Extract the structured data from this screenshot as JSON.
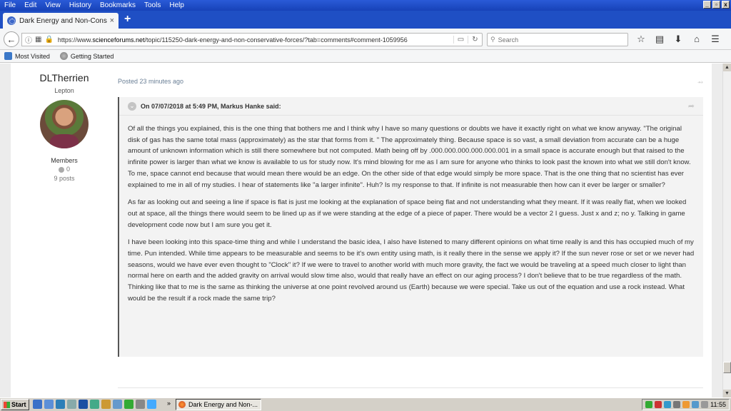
{
  "menu": [
    "File",
    "Edit",
    "View",
    "History",
    "Bookmarks",
    "Tools",
    "Help"
  ],
  "window_buttons": [
    "_",
    "▫",
    "x"
  ],
  "tab": {
    "title": "Dark Energy and Non-Conser...",
    "close": "×"
  },
  "newtab": "+",
  "nav": {
    "url_prefix": "https://www.",
    "url_domain": "scienceforums.net",
    "url_rest": "/topic/115250-dark-energy-and-non-conservative-forces/?tab=comments#comment-1059956",
    "search_placeholder": "Search"
  },
  "bookmarks": [
    "Most Visited",
    "Getting Started"
  ],
  "author": {
    "name": "DLTherrien",
    "rank": "Lepton",
    "group": "Members",
    "reputation": "0",
    "posts": "9 posts"
  },
  "post": {
    "meta": "Posted 23 minutes ago",
    "quote_header": "On 07/07/2018 at 5:49 PM, Markus Hanke said:",
    "paragraphs": [
      "Of all the things you explained, this is the one thing that bothers me and I think why I have so many questions or doubts we have it exactly right on what we know anyway. \"The original disk of gas has the same total mass (approximately) as the star that forms from it. \" The approximately thing. Because space is so vast, a small deviation from accurate can be a huge amount of unknown information which is still there somewhere but not computed. Math being off by .000.000.000.000.000.001 in a small space is accurate enough but that raised to the infinite power is larger than what we know is available to us for study now. It's mind blowing for me as I am sure for anyone who thinks to look past the known into what we still don't know. To me, space cannot end because that would mean there would be an edge. On the other side of that edge would simply be more space. That is the one thing that no scientist has ever explained to me in all of my studies. I hear of statements like \"a larger infinite\". Huh? Is my response to that. If infinite is not measurable then how can it ever be larger or smaller?",
      "As far as looking out and seeing a line if space is flat is just me looking at the explanation of space being flat and not understanding what they meant. If it was really flat, when we looked out at space, all the things there would seem to be lined up as if we were standing at the edge of a piece of paper. There would be a vector 2 I guess. Just x and z; no y. Talking in game development code now but I am sure you get it.",
      "I have been looking into this space-time thing and while I understand the basic idea, I also have listened to many different opinions on what time really is and this has occupied much of my time. Pun intended. While time appears to be measurable and seems to be it's own entity using math, is it really there in the sense we apply it? If the sun never rose or set or we never had seasons, would we have ever even thought to \"Clock\" it? If we were to travel to another world with much more gravity, the fact we would be traveling at a speed much closer to light than normal here on earth and the added gravity on arrival would slow time also, would that really have an effect on our aging process? I don't believe that to be true regardless of the math. Thinking like that to me is the same as thinking the universe at one point revolved around us (Earth) because we were special. Take us out of the equation and use a rock instead. What would be the result if a rock made the same trip?"
    ]
  },
  "taskbar": {
    "start": "Start",
    "task": "Dark Energy and Non-...",
    "clock": "11:55",
    "overflow": "»"
  }
}
